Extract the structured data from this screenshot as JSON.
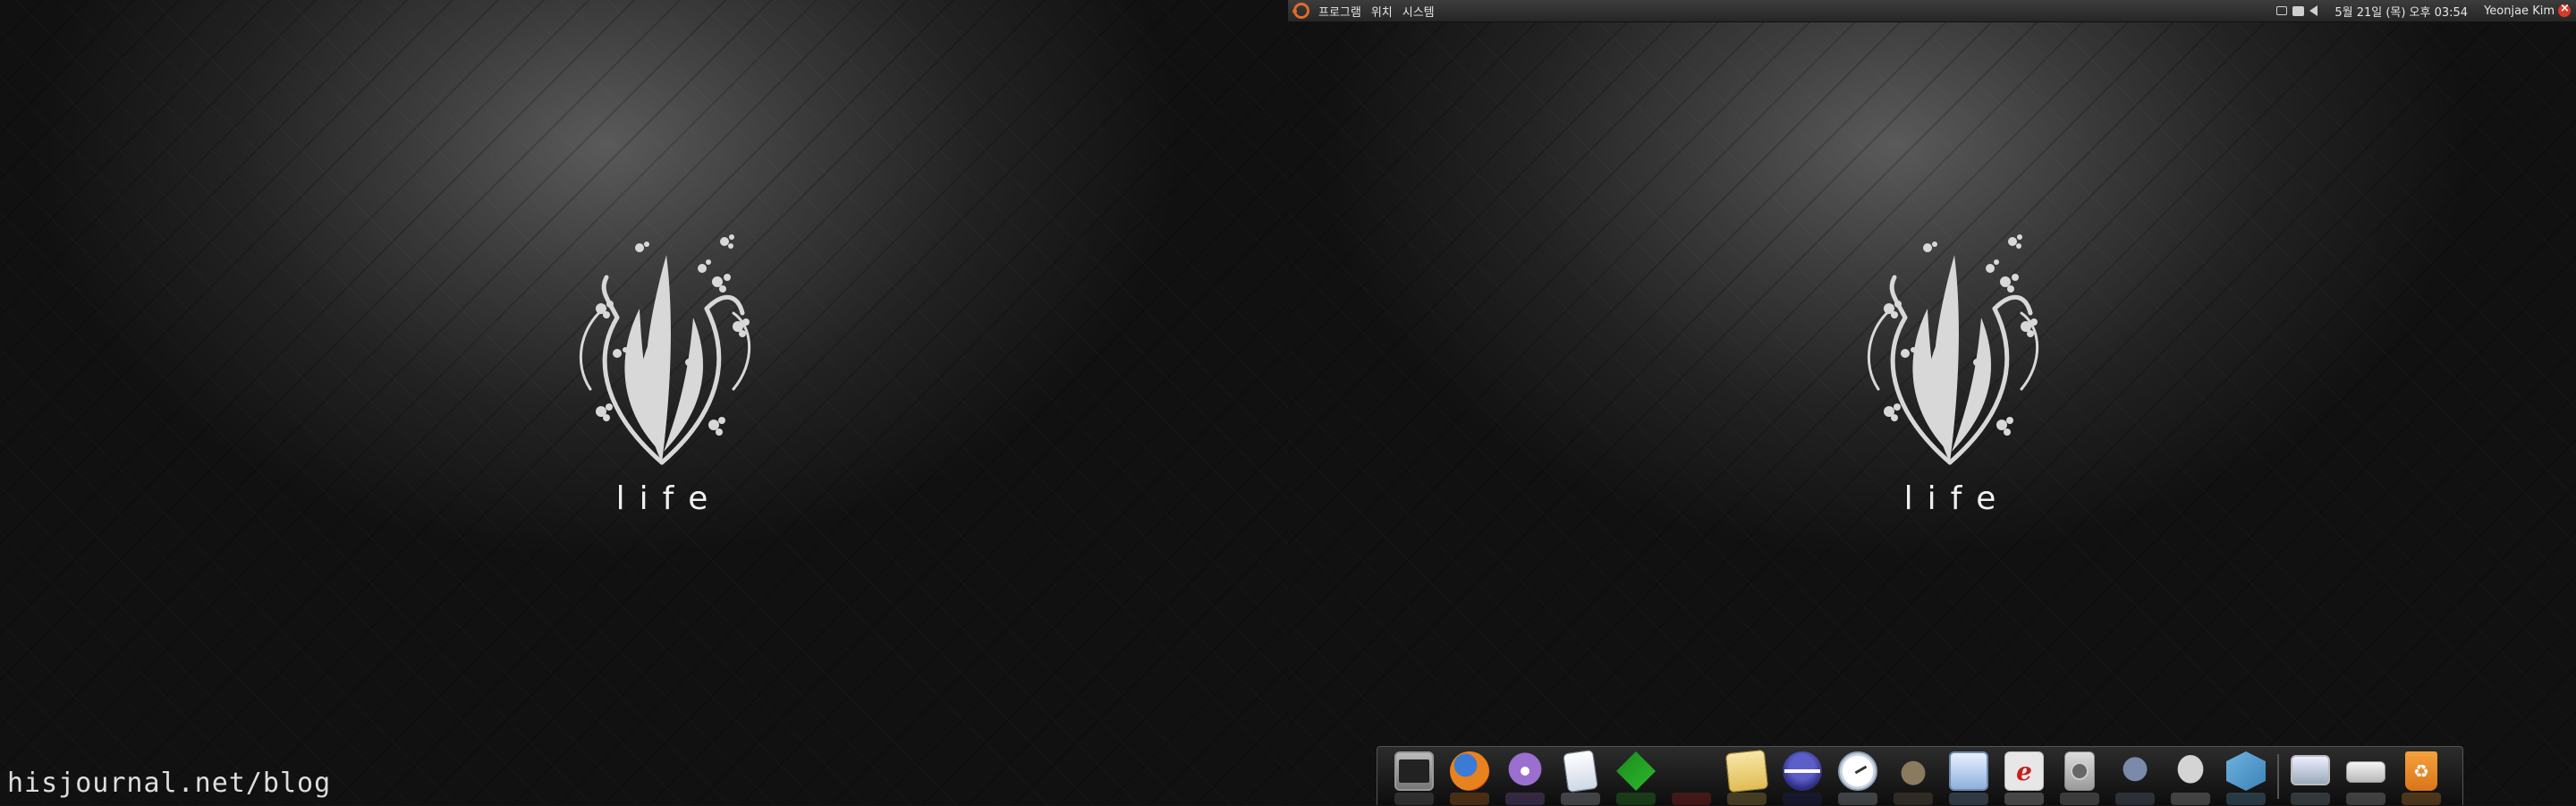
{
  "top_panel": {
    "menus": [
      "프로그램",
      "위치",
      "시스템"
    ],
    "clock": "5월 21일 (목) 오후 03:54",
    "user": "Yeonjae Kim"
  },
  "wallpaper": {
    "logo_text": "life"
  },
  "watermark": "hisjournal.net/blog",
  "dock": {
    "items": [
      "terminal-icon",
      "firefox-icon",
      "pidgin-icon",
      "notes-icon",
      "vim-icon",
      "colors-icon",
      "text-editor-icon",
      "eclipse-icon",
      "clock-icon",
      "gimp-icon",
      "screenshot-icon",
      "e-icon",
      "disk-icon",
      "tools-icon",
      "cloud-icon",
      "virtualbox-icon",
      "monitor-icon",
      "drive-icon",
      "trash-icon"
    ],
    "e_label": "e"
  },
  "colors": {
    "ubuntu_orange": "#e06b2c",
    "panel": "#2f2f2f",
    "logo": "#d8d8d8"
  }
}
